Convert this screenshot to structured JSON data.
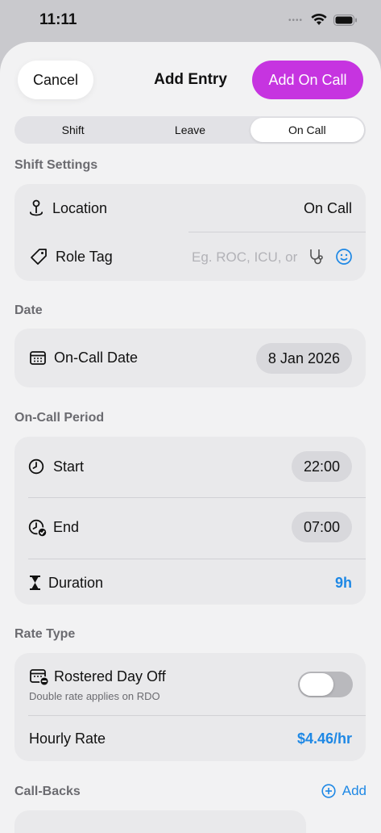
{
  "status_bar": {
    "time": "11:11"
  },
  "nav": {
    "cancel": "Cancel",
    "title": "Add Entry",
    "add": "Add On Call"
  },
  "tabs": [
    {
      "label": "Shift",
      "active": false
    },
    {
      "label": "Leave",
      "active": false
    },
    {
      "label": "On Call",
      "active": true
    }
  ],
  "shift_settings": {
    "title": "Shift Settings",
    "location_label": "Location",
    "location_value": "On Call",
    "role_tag_label": "Role Tag",
    "role_tag_placeholder": "Eg. ROC, ICU, or"
  },
  "date": {
    "title": "Date",
    "label": "On-Call Date",
    "value": "8 Jan 2026"
  },
  "period": {
    "title": "On-Call Period",
    "start_label": "Start",
    "start_value": "22:00",
    "end_label": "End",
    "end_value": "07:00",
    "duration_label": "Duration",
    "duration_value": "9h"
  },
  "rate": {
    "title": "Rate Type",
    "rdo_label": "Rostered Day Off",
    "rdo_sub": "Double rate applies on RDO",
    "rdo_on": false,
    "hourly_label": "Hourly Rate",
    "hourly_value": "$4.46/hr"
  },
  "callbacks": {
    "title": "Call-Backs",
    "add": "Add"
  },
  "colors": {
    "accent": "#c634e0",
    "link": "#1e88e5",
    "background": "#f2f2f3",
    "card": "#e9e9eb"
  }
}
